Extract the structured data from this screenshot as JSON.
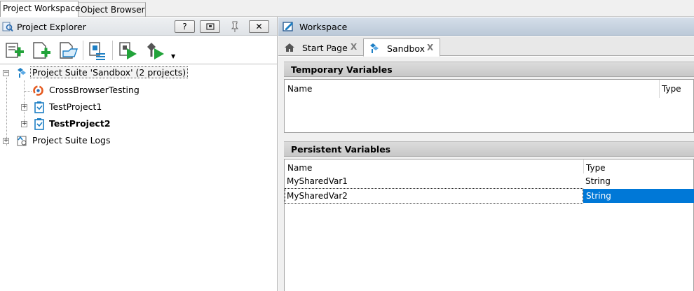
{
  "top_tabs": [
    {
      "label": "Project Workspace",
      "active": true
    },
    {
      "label": "Object Browser",
      "active": false
    }
  ],
  "explorer": {
    "title": "Project Explorer",
    "buttons": {
      "help": "?",
      "restore": "▫",
      "close": "✕"
    },
    "toolbar": [
      {
        "icon": "add-new-item-icon"
      },
      {
        "icon": "add-new-project-icon"
      },
      {
        "icon": "open-existing-icon"
      },
      {
        "icon": "project-suite-properties-icon"
      },
      {
        "icon": "run-project-icon"
      },
      {
        "icon": "run-project-suite-icon"
      }
    ],
    "tree": [
      {
        "label": "Project Suite 'Sandbox' (2 projects)",
        "bold": false,
        "selected": true
      },
      {
        "label": "CrossBrowserTesting",
        "bold": false
      },
      {
        "label": "TestProject1",
        "bold": false
      },
      {
        "label": "TestProject2",
        "bold": true
      },
      {
        "label": "Project Suite Logs",
        "bold": false
      }
    ]
  },
  "workspace": {
    "title": "Workspace",
    "tabs": [
      {
        "label": "Start Page",
        "close": "X",
        "active": false
      },
      {
        "label": "Sandbox",
        "close": "X",
        "active": true
      }
    ],
    "temporary": {
      "header": "Temporary Variables",
      "columns": [
        "Name",
        "Type"
      ],
      "rows": []
    },
    "persistent": {
      "header": "Persistent Variables",
      "columns": [
        "Name",
        "Type"
      ],
      "rows": [
        {
          "name": "MySharedVar1",
          "type": "String"
        },
        {
          "name": "MySharedVar2",
          "type": "String",
          "selected": true
        }
      ]
    }
  },
  "colors": {
    "selection": "#0078d7",
    "ws_header": "#c9d4e1",
    "accent_green": "#22a33a",
    "accent_blue": "#1d7fc4"
  }
}
